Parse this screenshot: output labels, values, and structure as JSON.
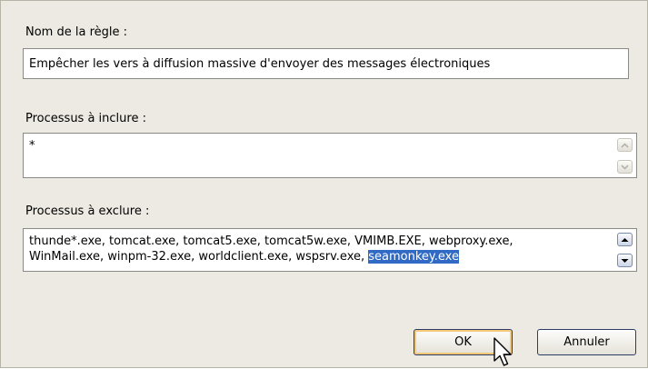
{
  "dialog": {
    "rule_name": {
      "label": "Nom de la règle :",
      "value": "Empêcher les vers à  diffusion massive d'envoyer des messages électroniques"
    },
    "include": {
      "label": "Processus à inclure :",
      "value": "*"
    },
    "exclude": {
      "label": "Processus à exclure :",
      "line1": "thunde*.exe, tomcat.exe, tomcat5.exe, tomcat5w.exe, VMIMB.EXE, webproxy.exe,",
      "line2_before_selection": "WinMail.exe, winpm-32.exe, worldclient.exe, wspsrv.exe, ",
      "line2_selected": "seamonkey.exe"
    },
    "buttons": {
      "ok": "OK",
      "cancel": "Annuler"
    }
  },
  "icons": {
    "scroll_up": "chevron-up-icon",
    "scroll_down": "chevron-down-icon",
    "cursor": "pointer-arrow-icon"
  },
  "colors": {
    "dialog_background": "#eceae2",
    "selection": "#316ac5",
    "default_button_glow": "#f4c878"
  }
}
